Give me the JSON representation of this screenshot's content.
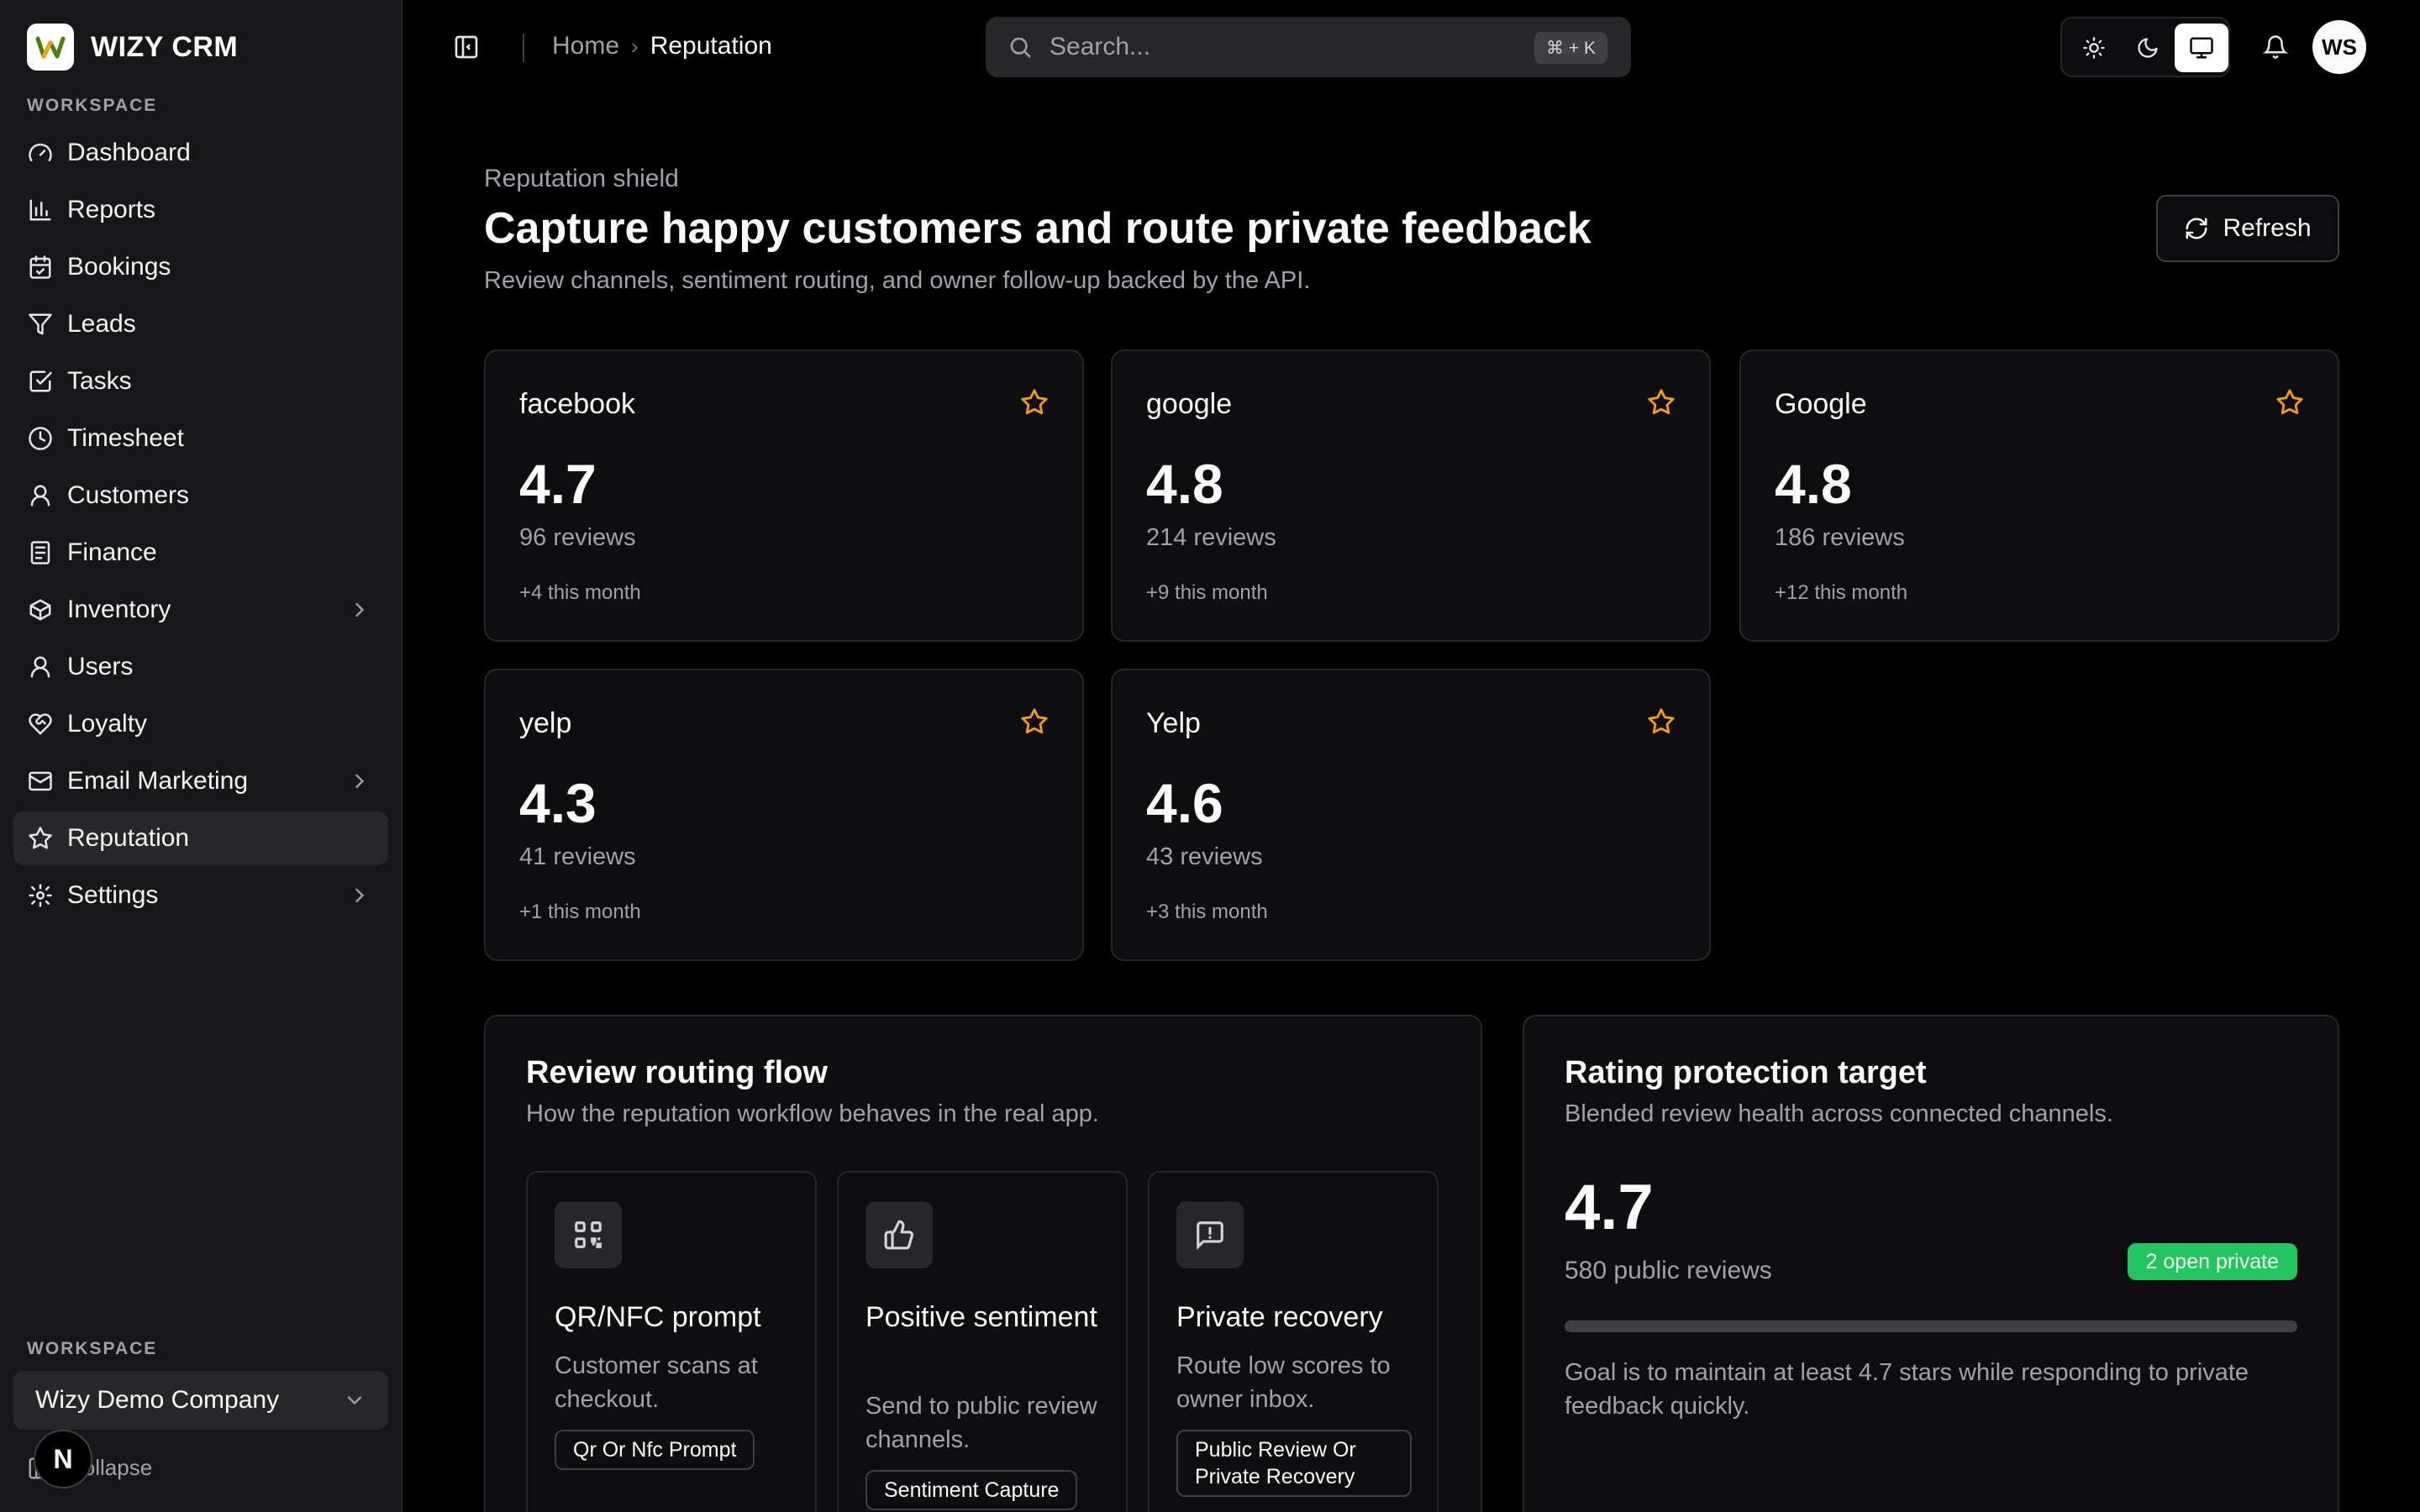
{
  "app": {
    "name": "WIZY CRM"
  },
  "sidebar": {
    "section_label": "WORKSPACE",
    "items": [
      {
        "label": "Dashboard",
        "icon": "gauge-icon"
      },
      {
        "label": "Reports",
        "icon": "bar-chart-icon"
      },
      {
        "label": "Bookings",
        "icon": "calendar-icon"
      },
      {
        "label": "Leads",
        "icon": "funnel-icon"
      },
      {
        "label": "Tasks",
        "icon": "checkbox-icon"
      },
      {
        "label": "Timesheet",
        "icon": "clock-icon"
      },
      {
        "label": "Customers",
        "icon": "user-icon"
      },
      {
        "label": "Finance",
        "icon": "receipt-icon"
      },
      {
        "label": "Inventory",
        "icon": "box-icon",
        "has_children": true
      },
      {
        "label": "Users",
        "icon": "user-icon"
      },
      {
        "label": "Loyalty",
        "icon": "heart-handshake-icon"
      },
      {
        "label": "Email Marketing",
        "icon": "mail-icon",
        "has_children": true
      },
      {
        "label": "Reputation",
        "icon": "star-icon",
        "active": true
      },
      {
        "label": "Settings",
        "icon": "gear-icon",
        "has_children": true
      }
    ],
    "footer_section_label": "WORKSPACE",
    "workspace_name": "Wizy Demo Company",
    "collapse_label": "Collapse",
    "n_badge": "N"
  },
  "header": {
    "breadcrumb": {
      "home": "Home",
      "separator": "›",
      "current": "Reputation"
    },
    "search": {
      "placeholder": "Search...",
      "shortcut": "⌘ + K"
    },
    "theme_modes": [
      "light",
      "dark",
      "system"
    ],
    "theme_selected": "system",
    "avatar_initials": "WS"
  },
  "page": {
    "eyebrow": "Reputation shield",
    "title": "Capture happy customers and route private feedback",
    "subtitle": "Review channels, sentiment routing, and owner follow-up backed by the API.",
    "refresh_label": "Refresh"
  },
  "channels": [
    {
      "name": "facebook",
      "score": "4.7",
      "reviews": "96 reviews",
      "delta": "+4 this month"
    },
    {
      "name": "google",
      "score": "4.8",
      "reviews": "214 reviews",
      "delta": "+9 this month"
    },
    {
      "name": "Google",
      "score": "4.8",
      "reviews": "186 reviews",
      "delta": "+12 this month"
    },
    {
      "name": "yelp",
      "score": "4.3",
      "reviews": "41 reviews",
      "delta": "+1 this month"
    },
    {
      "name": "Yelp",
      "score": "4.6",
      "reviews": "43 reviews",
      "delta": "+3 this month"
    }
  ],
  "routing": {
    "title": "Review routing flow",
    "subtitle": "How the reputation workflow behaves in the real app.",
    "steps": [
      {
        "title": "QR/NFC prompt",
        "desc": "Customer scans at checkout.",
        "tag": "Qr Or Nfc Prompt",
        "icon": "qr-code-icon"
      },
      {
        "title": "Positive sentiment",
        "desc": "Send to public review channels.",
        "tag": "Sentiment Capture",
        "icon": "thumbs-up-icon"
      },
      {
        "title": "Private recovery",
        "desc": "Route low scores to owner inbox.",
        "tag": "Public Review Or Private Recovery",
        "icon": "message-alert-icon"
      }
    ]
  },
  "protection": {
    "title": "Rating protection target",
    "subtitle": "Blended review health across connected channels.",
    "score": "4.7",
    "reviews": "580 public reviews",
    "badge": "2 open private",
    "progress_percent": 0,
    "note": "Goal is to maintain at least 4.7 stars while responding to private feedback quickly."
  },
  "colors": {
    "accent_star": "#f59e0b",
    "badge_green": "#22c55e",
    "sidebar_bg": "#17171a"
  }
}
